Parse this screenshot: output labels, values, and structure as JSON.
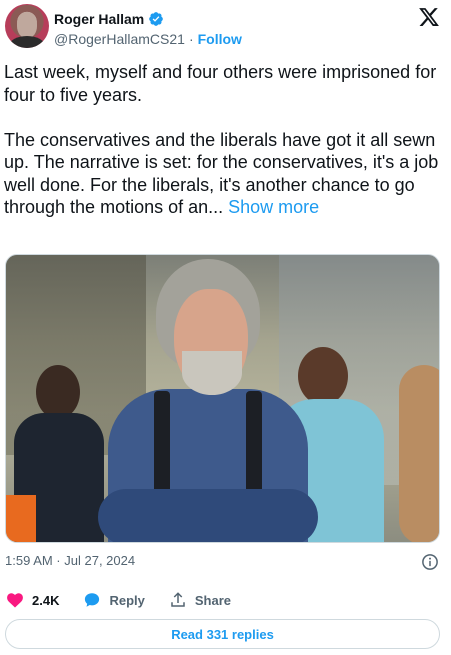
{
  "author": {
    "name": "Roger Hallam",
    "handle": "@RogerHallamCS21",
    "separator": "·",
    "follow_label": "Follow",
    "verified": true
  },
  "tweet": {
    "paragraph1": "Last week, myself and four others were imprisoned for four to five years.",
    "paragraph2": "The conservatives and the liberals have got it all sewn up. The narrative is set: for the conservatives, it's a job well done. For the liberals, it's another chance to go through the motions of an... ",
    "show_more_label": "Show more"
  },
  "meta": {
    "timestamp": "1:59 AM · Jul 27, 2024"
  },
  "actions": {
    "likes_count": "2.4K",
    "reply_label": "Reply",
    "share_label": "Share"
  },
  "read_replies_label": "Read 331 replies",
  "icons": {
    "verified": "verified-badge-icon",
    "x_logo": "x-logo-icon",
    "info": "info-icon",
    "heart": "heart-icon",
    "reply": "reply-bubble-icon",
    "share": "share-upload-icon"
  },
  "colors": {
    "accent": "#1d9bf0",
    "like": "#f91880",
    "text": "#0f1419",
    "secondary": "#536471"
  }
}
